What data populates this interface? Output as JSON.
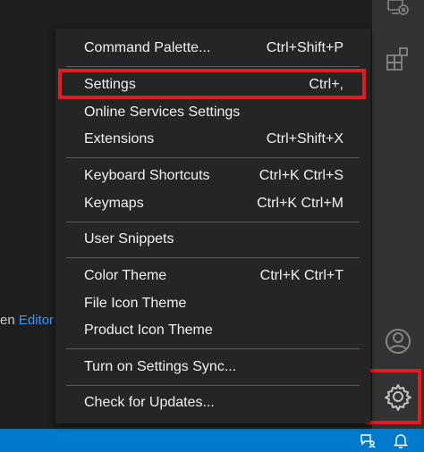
{
  "editor": {
    "hint_prefix": "en",
    "hint_link": "Editor"
  },
  "menu": {
    "items": [
      {
        "label": "Command Palette...",
        "shortcut": "Ctrl+Shift+P"
      },
      {
        "label": "Settings",
        "shortcut": "Ctrl+,"
      },
      {
        "label": "Online Services Settings",
        "shortcut": ""
      },
      {
        "label": "Extensions",
        "shortcut": "Ctrl+Shift+X"
      },
      {
        "label": "Keyboard Shortcuts",
        "shortcut": "Ctrl+K Ctrl+S"
      },
      {
        "label": "Keymaps",
        "shortcut": "Ctrl+K Ctrl+M"
      },
      {
        "label": "User Snippets",
        "shortcut": ""
      },
      {
        "label": "Color Theme",
        "shortcut": "Ctrl+K Ctrl+T"
      },
      {
        "label": "File Icon Theme",
        "shortcut": ""
      },
      {
        "label": "Product Icon Theme",
        "shortcut": ""
      },
      {
        "label": "Turn on Settings Sync...",
        "shortcut": ""
      },
      {
        "label": "Check for Updates...",
        "shortcut": ""
      }
    ]
  },
  "activity_bar": {
    "icons": [
      "remote-explorer-icon",
      "extensions-icon",
      "account-icon",
      "manage-gear-icon"
    ]
  },
  "status_bar": {
    "icons": [
      "feedback-icon",
      "notifications-bell-icon"
    ]
  },
  "colors": {
    "highlight": "#e31b23",
    "status_bar": "#007acc",
    "link": "#3794ff"
  }
}
